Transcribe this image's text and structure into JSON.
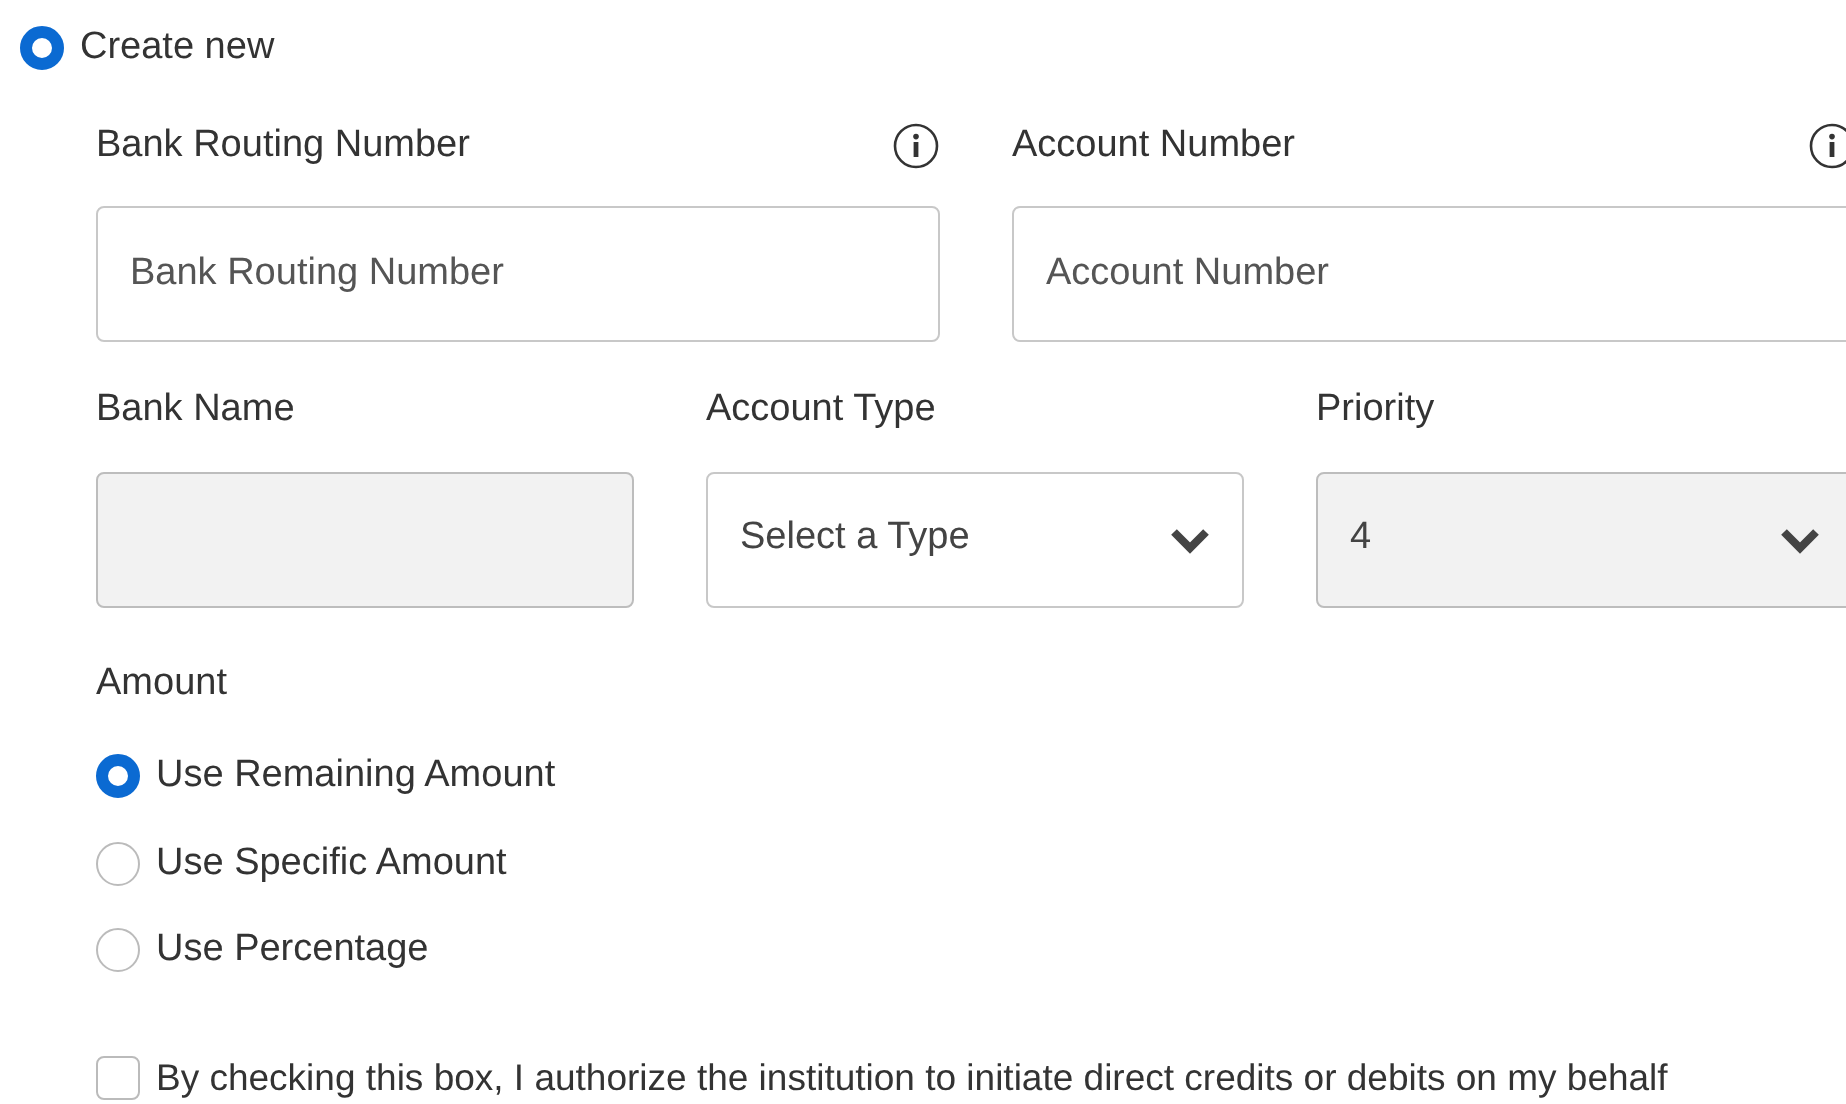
{
  "mode_option": {
    "label": "Create new",
    "selected": true
  },
  "fields_row_1": [
    {
      "kind": "input",
      "label": "Bank Routing Number",
      "placeholder": "Bank Routing Number",
      "info": true,
      "disabled": false
    },
    {
      "kind": "input",
      "label": "Account Number",
      "placeholder": "Account Number",
      "info": true,
      "disabled": false
    }
  ],
  "fields_row_2": [
    {
      "kind": "input",
      "label": "Bank Name",
      "disabled": true
    },
    {
      "kind": "select",
      "label": "Account Type",
      "value": "Select a Type",
      "disabled": false
    },
    {
      "kind": "select",
      "label": "Priority",
      "value": "4",
      "disabled": true
    }
  ],
  "amount": {
    "label": "Amount",
    "options": [
      {
        "label": "Use Remaining Amount",
        "selected": true
      },
      {
        "label": "Use Specific Amount",
        "selected": false
      },
      {
        "label": "Use Percentage",
        "selected": false
      }
    ]
  },
  "authorization": {
    "label": "By checking this box, I authorize the institution to initiate direct credits or debits on my behalf",
    "checked": false
  }
}
